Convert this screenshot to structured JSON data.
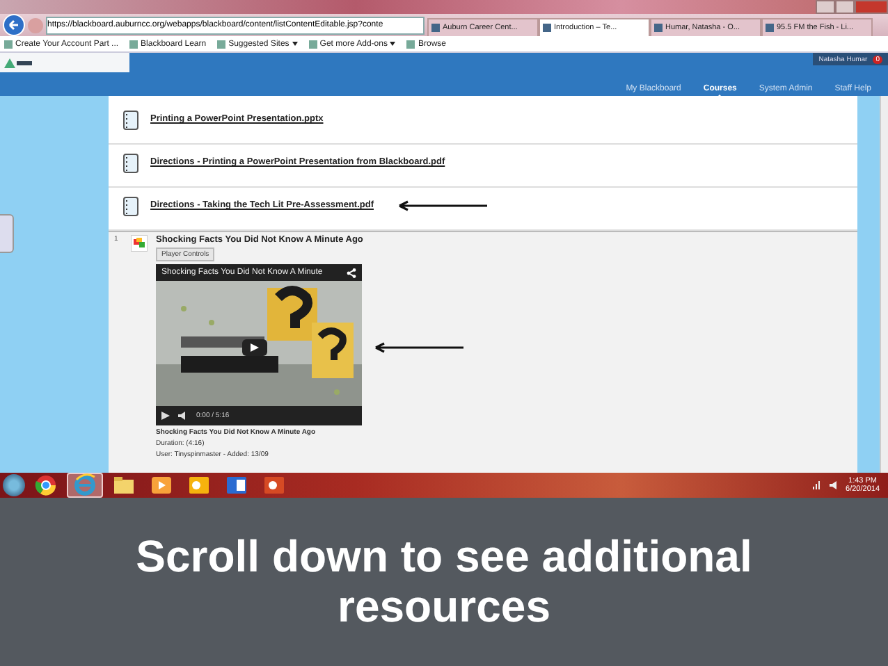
{
  "browser": {
    "address": "https://blackboard.auburncc.org/webapps/blackboard/content/listContentEditable.jsp?conte",
    "tabs": [
      {
        "label": "Auburn Career Cent...",
        "selected": false
      },
      {
        "label": "Introduction – Te...",
        "selected": true
      },
      {
        "label": "Humar, Natasha - O...",
        "selected": false
      },
      {
        "label": "95.5 FM the Fish - Li...",
        "selected": false
      }
    ],
    "favorites": [
      {
        "label": "Create Your Account Part ...",
        "kind": "link"
      },
      {
        "label": "Blackboard Learn",
        "kind": "link"
      },
      {
        "label": "Suggested Sites",
        "kind": "menu"
      },
      {
        "label": "Get more Add-ons",
        "kind": "menu"
      },
      {
        "label": "Browse",
        "kind": "link"
      }
    ]
  },
  "blackboard": {
    "user": "Natasha Humar",
    "notifications": "0",
    "nav": [
      {
        "label": "My Blackboard",
        "selected": false
      },
      {
        "label": "Courses",
        "selected": true
      },
      {
        "label": "System Admin",
        "selected": false
      },
      {
        "label": "Staff Help",
        "selected": false
      }
    ]
  },
  "content": {
    "files": [
      {
        "title": "Printing a PowerPoint Presentation.pptx",
        "pointed": false
      },
      {
        "title": "Directions - Printing a PowerPoint Presentation from Blackboard.pdf",
        "pointed": false
      },
      {
        "title": "Directions - Taking the Tech Lit Pre-Assessment.pdf",
        "pointed": true
      }
    ],
    "video_item": {
      "index": "1",
      "title": "Shocking Facts You Did Not Know A Minute Ago",
      "player_button": "Player Controls",
      "player": {
        "title": "Shocking Facts You Did Not Know A Minute",
        "time": "0:00 / 5:16"
      },
      "caption_title": "Shocking Facts You Did Not Know A Minute Ago",
      "duration": "Duration: (4:16)",
      "user": "User: Tinyspinmaster - Added: 13/09",
      "pointed": true
    }
  },
  "taskbar": {
    "apps": [
      {
        "kind": "chrome",
        "selected": false
      },
      {
        "kind": "ie",
        "selected": true
      },
      {
        "kind": "folder",
        "selected": false
      },
      {
        "kind": "media",
        "selected": false
      },
      {
        "kind": "outlook",
        "selected": false
      },
      {
        "kind": "word",
        "selected": false
      },
      {
        "kind": "powerpoint",
        "selected": false
      }
    ],
    "time": "1:43 PM",
    "date": "6/20/2014"
  },
  "caption": "Scroll down to see additional resources"
}
